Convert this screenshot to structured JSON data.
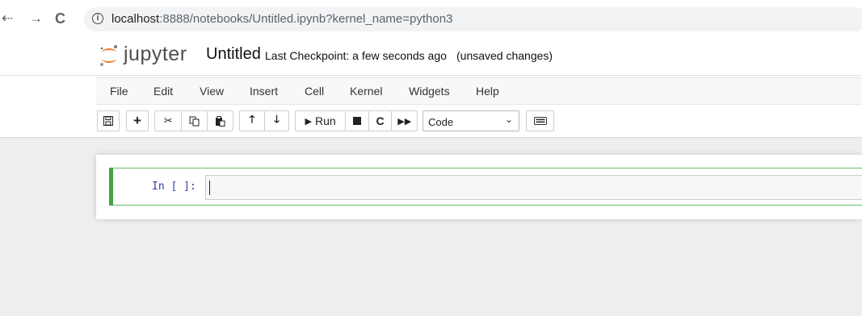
{
  "browser": {
    "back_icon": "back-arrow-icon",
    "forward_icon": "forward-arrow-icon",
    "reload_icon": "reload-icon",
    "url_host": "localhost",
    "url_rest": ":8888/notebooks/Untitled.ipynb?kernel_name=python3"
  },
  "header": {
    "logo_text": "jupyter",
    "notebook_title": "Untitled",
    "checkpoint": "Last Checkpoint: a few seconds ago",
    "unsaved": "(unsaved changes)"
  },
  "menu": {
    "items": [
      "File",
      "Edit",
      "View",
      "Insert",
      "Cell",
      "Kernel",
      "Widgets",
      "Help"
    ]
  },
  "toolbar": {
    "run_label": "Run",
    "cell_type": "Code",
    "icons": [
      "save-icon",
      "add-cell-icon",
      "cut-icon",
      "copy-icon",
      "paste-icon",
      "move-up-icon",
      "move-down-icon",
      "run-icon",
      "stop-icon",
      "restart-icon",
      "fast-forward-icon",
      "keyboard-icon"
    ]
  },
  "cell": {
    "prompt": "In [ ]:",
    "code": ""
  },
  "colors": {
    "accent_green": "#42a545",
    "prompt_blue": "#303f9f",
    "jupyter_orange": "#f37626"
  }
}
